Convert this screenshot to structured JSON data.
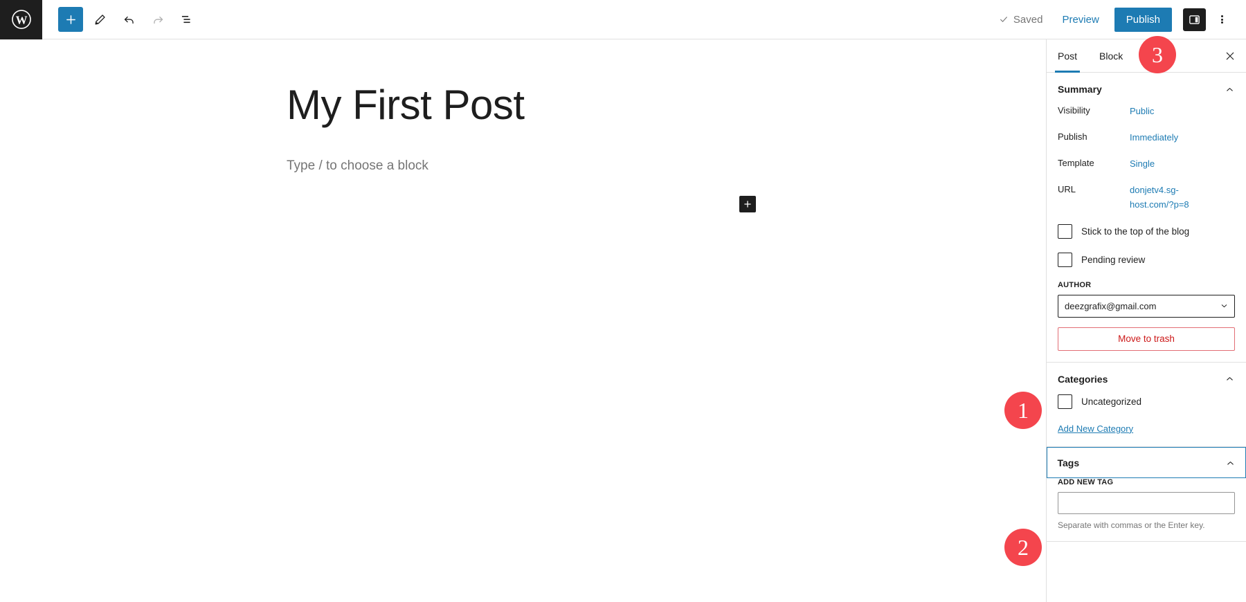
{
  "topbar": {
    "logo_icon": "wordpress-logo-icon",
    "tools": [
      {
        "name": "add-block-button",
        "icon": "plus-icon",
        "label": "Add block"
      },
      {
        "name": "edit-tool-button",
        "icon": "pencil-icon",
        "label": "Tools"
      },
      {
        "name": "undo-button",
        "icon": "undo-arrow-icon",
        "label": "Undo"
      },
      {
        "name": "redo-button",
        "icon": "redo-arrow-icon",
        "label": "Redo"
      },
      {
        "name": "list-view-button",
        "icon": "list-view-icon",
        "label": "Document Overview"
      }
    ],
    "saved_label": "Saved",
    "saved_icon": "checkmark-icon",
    "preview_label": "Preview",
    "publish_label": "Publish",
    "settings_icon": "sidebar-panel-icon",
    "more_icon": "three-dots-vertical-icon"
  },
  "editor": {
    "post_title": "My First Post",
    "block_placeholder": "Type / to choose a block",
    "inserter_icon": "plus-icon"
  },
  "sidebar": {
    "tabs": [
      {
        "label": "Post",
        "active": true
      },
      {
        "label": "Block",
        "active": false
      }
    ],
    "close_icon": "close-x-icon",
    "summary": {
      "title": "Summary",
      "collapse_icon": "chevron-up-icon",
      "rows": [
        {
          "label": "Visibility",
          "value": "Public"
        },
        {
          "label": "Publish",
          "value": "Immediately"
        },
        {
          "label": "Template",
          "value": "Single"
        },
        {
          "label": "URL",
          "value": "donjetv4.sg-host.com/?p=8"
        }
      ],
      "checkboxes": [
        {
          "label": "Stick to the top of the blog",
          "checked": false
        },
        {
          "label": "Pending review",
          "checked": false
        }
      ],
      "author_label": "AUTHOR",
      "author_value": "deezgrafix@gmail.com",
      "author_chevron_icon": "chevron-down-icon",
      "trash_label": "Move to trash"
    },
    "categories": {
      "title": "Categories",
      "collapse_icon": "chevron-up-icon",
      "items": [
        {
          "label": "Uncategorized",
          "checked": false
        }
      ],
      "add_link": "Add New Category"
    },
    "tags": {
      "title": "Tags",
      "collapse_icon": "chevron-up-icon",
      "field_label": "ADD NEW TAG",
      "input_value": "",
      "input_placeholder": "",
      "help_text": "Separate with commas or the Enter key."
    }
  },
  "badges": [
    {
      "id": "badge-1",
      "number": "1"
    },
    {
      "id": "badge-2",
      "number": "2"
    },
    {
      "id": "badge-3",
      "number": "3"
    }
  ],
  "colors": {
    "accent_blue": "#1d7bb3",
    "badge_red": "#f4454d",
    "dark": "#1e1e1e",
    "danger": "#cc1818"
  }
}
